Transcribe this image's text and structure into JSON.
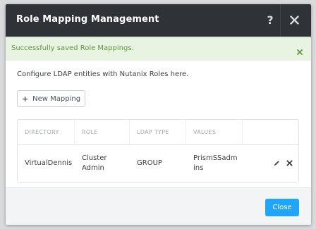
{
  "dialog": {
    "title": "Role Mapping Management",
    "help_symbol": "?",
    "close_icon": "close-icon"
  },
  "alert": {
    "message": "Successfully saved Role Mappings.",
    "dismiss_icon": "close-icon",
    "color": "#5b9a3d"
  },
  "content": {
    "intro": "Configure LDAP entities with Nutanix Roles here.",
    "new_mapping_label": "New Mapping",
    "new_mapping_icon": "plus-icon"
  },
  "table": {
    "columns": [
      "DIRECTORY",
      "ROLE",
      "LDAP TYPE",
      "VALUES"
    ],
    "rows": [
      {
        "directory": "VirtualDennis",
        "role": "Cluster Admin",
        "ldap_type": "GROUP",
        "values": "PrismSSadmins",
        "actions": [
          "pencil-icon",
          "delete-icon"
        ]
      }
    ]
  },
  "footer": {
    "close_label": "Close",
    "accent": "#22a5f7"
  }
}
